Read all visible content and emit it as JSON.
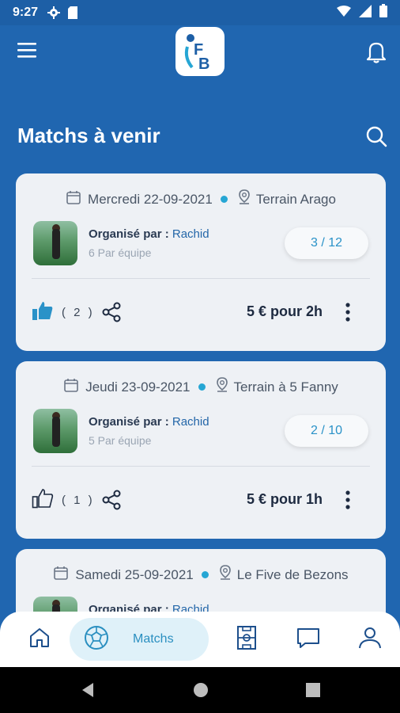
{
  "status_bar": {
    "time": "9:27"
  },
  "header": {
    "logo_text": "FB",
    "page_title": "Matchs à venir"
  },
  "colors": {
    "primary": "#2066b0",
    "accent": "#26a6d4",
    "card_bg": "#eef1f5"
  },
  "matches": [
    {
      "date": "Mercredi 22-09-2021",
      "location": "Terrain Arago",
      "organiser_label": "Organisé par :",
      "organiser_name": "Rachid",
      "per_team": "6 Par équipe",
      "players": "3 / 12",
      "likes": "( 2 )",
      "liked": true,
      "price": "5 € pour 2h"
    },
    {
      "date": "Jeudi 23-09-2021",
      "location": "Terrain à 5 Fanny",
      "organiser_label": "Organisé par :",
      "organiser_name": "Rachid",
      "per_team": "5 Par équipe",
      "players": "2 / 10",
      "likes": "( 1 )",
      "liked": false,
      "price": "5 € pour 1h"
    },
    {
      "date": "Samedi 25-09-2021",
      "location": "Le Five de Bezons",
      "organiser_label": "Organisé par :",
      "organiser_name": "Rachid"
    }
  ],
  "bottom_nav": {
    "items": [
      {
        "icon": "home-icon"
      },
      {
        "icon": "soccer-ball-icon",
        "label": "Matchs",
        "active": true
      },
      {
        "icon": "field-icon"
      },
      {
        "icon": "chat-icon"
      },
      {
        "icon": "profile-icon"
      }
    ]
  }
}
